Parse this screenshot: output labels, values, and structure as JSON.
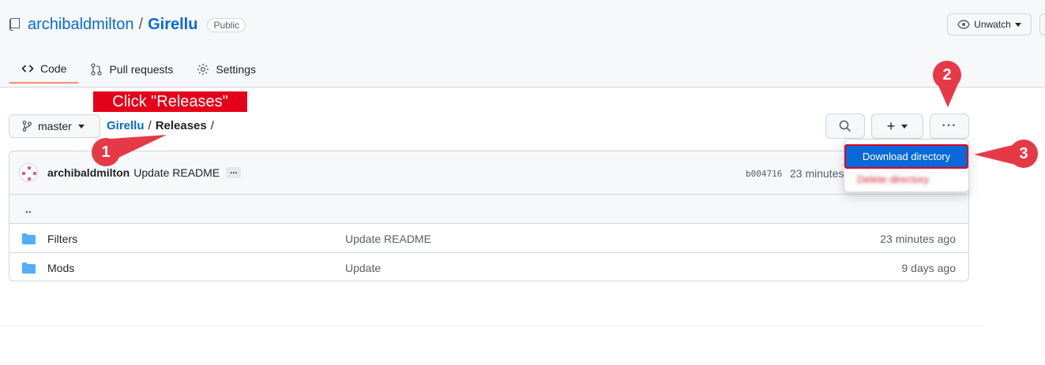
{
  "repo": {
    "owner": "archibaldmilton",
    "separator": "/",
    "name": "Girellu",
    "visibility": "Public",
    "unwatch_label": "Unwatch"
  },
  "tabs": [
    {
      "label": "Code",
      "icon": "code-icon",
      "active": true
    },
    {
      "label": "Pull requests",
      "icon": "pull-request-icon",
      "active": false
    },
    {
      "label": "Settings",
      "icon": "gear-icon",
      "active": false
    }
  ],
  "toolbar": {
    "branch": "master",
    "breadcrumb_root": "Girellu",
    "breadcrumb_sep": "/",
    "breadcrumb_current": "Releases",
    "breadcrumb_trailing": "/",
    "add_label": "+",
    "more_label": "···"
  },
  "commit": {
    "author": "archibaldmilton",
    "message": "Update README",
    "ellipsis": "...",
    "sha": "b004716",
    "time": "23 minutes"
  },
  "up_dir": "..",
  "files": [
    {
      "name": "Filters",
      "message": "Update README",
      "time": "23 minutes ago",
      "icon": "folder-icon"
    },
    {
      "name": "Mods",
      "message": "Update",
      "time": "9 days ago",
      "icon": "folder-icon"
    }
  ],
  "dropdown": {
    "download": "Download directory",
    "delete": "Delete directory"
  },
  "annotations": {
    "callout": "Click \"Releases\"",
    "markers": [
      "1",
      "2",
      "3"
    ],
    "color": "#e63946"
  },
  "colors": {
    "link": "#0969da",
    "accent_tab": "#fd8c73",
    "highlight": "#e5001a"
  }
}
